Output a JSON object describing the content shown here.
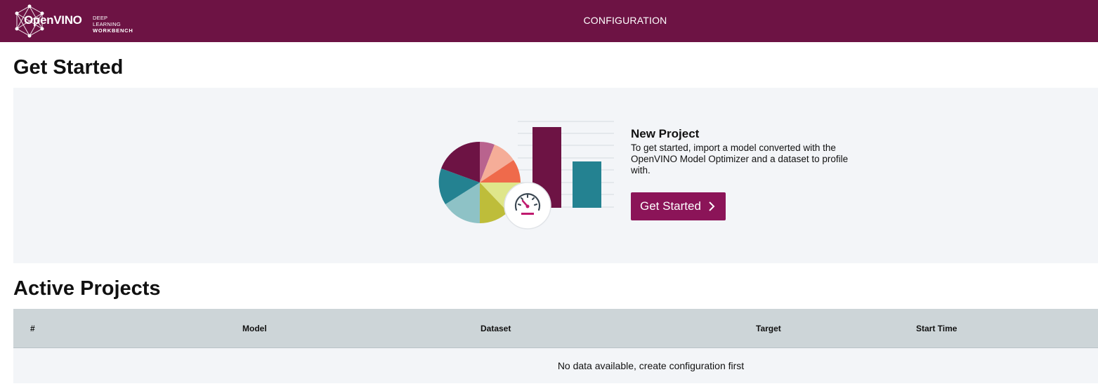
{
  "header": {
    "logo_word": "OpenVINO",
    "logo_sub_line1": "DEEP LEARNING",
    "logo_sub_line2": "WORKBENCH",
    "nav_item": "CONFIGURATION",
    "bg_color": "#6d1344"
  },
  "get_started": {
    "heading": "Get Started",
    "card": {
      "title": "New Project",
      "description": "To get started, import a model converted with the OpenVINO Model Optimizer and a dataset to profile with.",
      "button_label": "Get Started",
      "button_icon": "chevron-right-icon",
      "button_color": "#8b1458"
    },
    "illustration": {
      "icons": [
        "pie-chart-icon",
        "bar-chart-icon",
        "speedometer-icon"
      ]
    }
  },
  "active_projects": {
    "heading": "Active Projects",
    "columns": [
      "#",
      "Model",
      "Dataset",
      "Target",
      "Start Time"
    ],
    "rows": [],
    "empty_message": "No data available, create configuration first"
  }
}
